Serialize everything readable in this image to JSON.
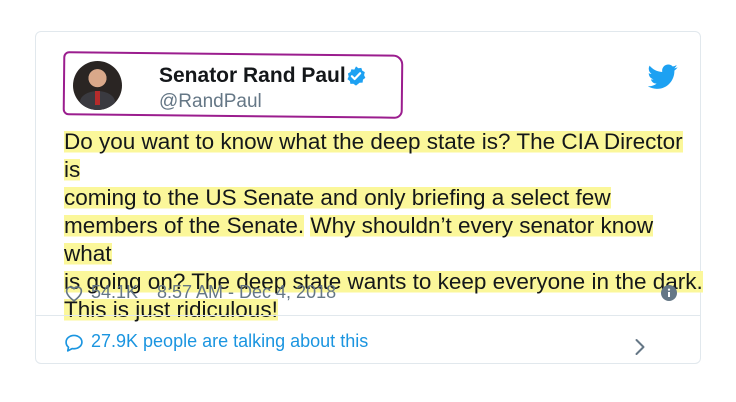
{
  "tweet": {
    "author_name": "Senator Rand Paul",
    "handle": "@RandPaul",
    "text_segments": [
      "Do you want to know what the deep state is? The CIA Director is",
      "coming to the US Senate and only briefing a select few",
      "members of the Senate.",
      "Why shouldn’t every senator know what",
      "is going on? The deep state wants to keep everyone in the dark.",
      "This is just ridiculous!"
    ],
    "likes": "54.1K",
    "timestamp": "8:57 AM - Dec 4, 2018",
    "talking": "27.9K people are talking about this"
  },
  "icons": {
    "verified": "verified-badge-icon",
    "bird": "twitter-bird-icon",
    "heart": "heart-icon",
    "info": "info-icon",
    "bubble": "comment-bubble-icon",
    "chevron": "chevron-right-icon"
  },
  "colors": {
    "twitter_blue": "#1da1f2",
    "link_blue": "#1b95e0",
    "highlight_yellow": "#fbf79a",
    "annotation_purple": "#9b1d8e",
    "text": "#14171a",
    "secondary_text": "#657786",
    "border": "#e1e8ed"
  }
}
